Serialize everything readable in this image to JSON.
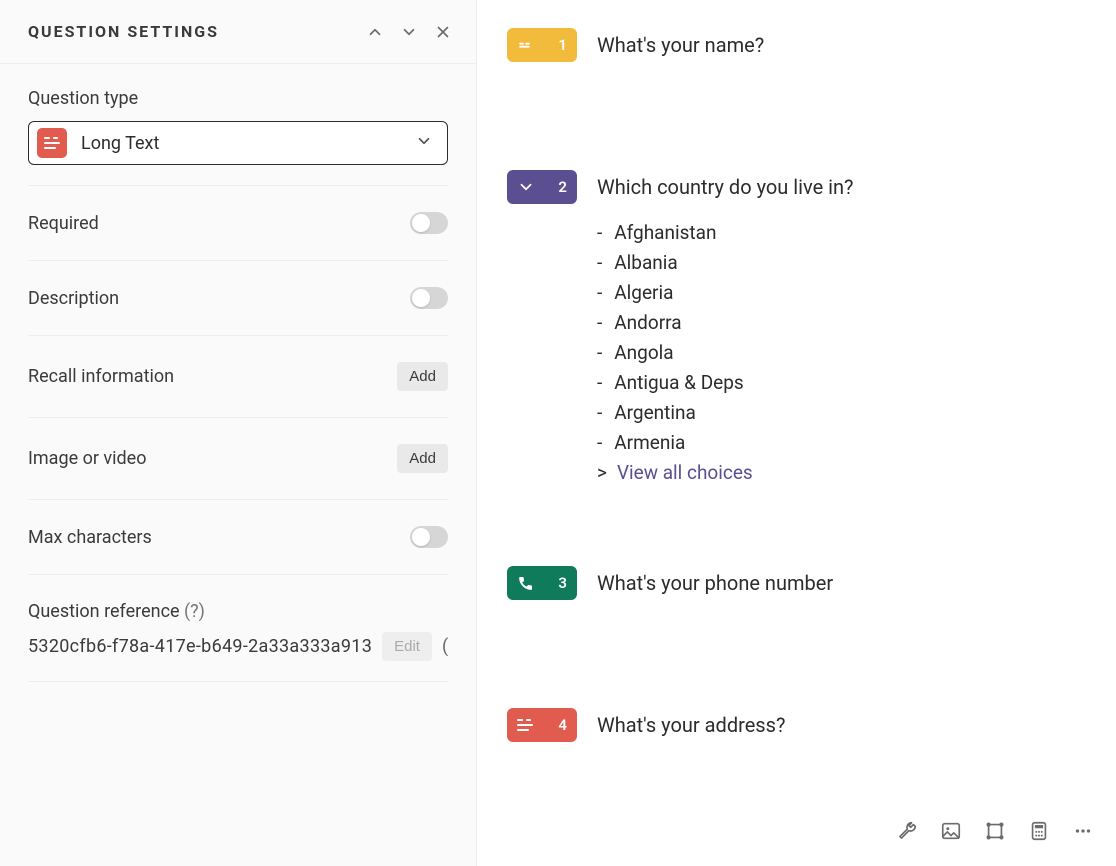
{
  "sidebar": {
    "title": "QUESTION SETTINGS",
    "question_type_label": "Question type",
    "question_type_value": "Long Text",
    "settings": {
      "required": {
        "label": "Required"
      },
      "description": {
        "label": "Description"
      },
      "recall": {
        "label": "Recall information",
        "button": "Add"
      },
      "media": {
        "label": "Image or video",
        "button": "Add"
      },
      "max_chars": {
        "label": "Max characters"
      }
    },
    "reference": {
      "label": "Question reference",
      "help": "(?)",
      "value": "5320cfb6-f78a-417e-b649-2a33a333a913",
      "edit_label": "Edit",
      "paren": "("
    }
  },
  "questions": [
    {
      "number": "1",
      "title": "What's your name?",
      "color": "yellow",
      "icon": "short-text-icon"
    },
    {
      "number": "2",
      "title": "Which country do you live in?",
      "color": "purple",
      "icon": "dropdown-icon",
      "choices": [
        "Afghanistan",
        "Albania",
        "Algeria",
        "Andorra",
        "Angola",
        "Antigua & Deps",
        "Argentina",
        "Armenia"
      ],
      "view_all": "View all choices"
    },
    {
      "number": "3",
      "title": "What's your phone number",
      "color": "green",
      "icon": "phone-icon"
    },
    {
      "number": "4",
      "title": "What's your address?",
      "color": "red",
      "icon": "long-text-icon"
    }
  ],
  "toolbar": {
    "icons": [
      "wrench-icon",
      "image-icon",
      "logic-icon",
      "calculator-icon",
      "more-icon"
    ]
  }
}
